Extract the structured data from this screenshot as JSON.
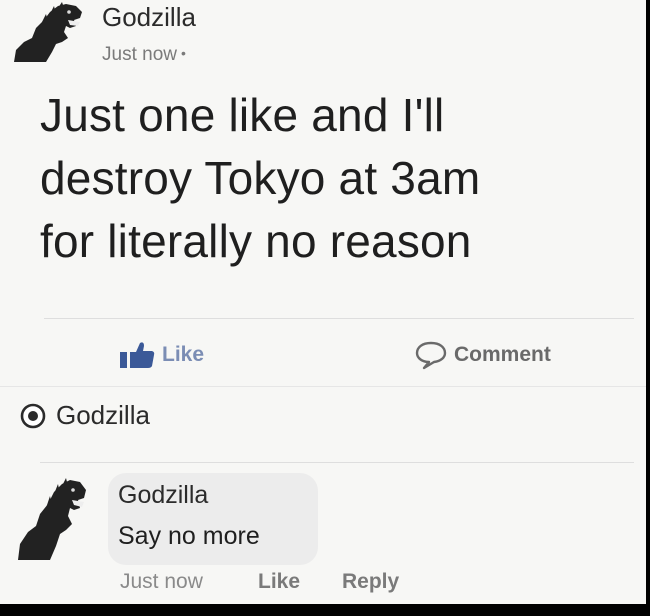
{
  "post": {
    "author": "Godzilla",
    "timestamp": "Just now",
    "privacy_separator": "•",
    "text_lines": [
      "Just one like and I'll",
      "destroy Tokyo at 3am",
      "for literally no reason"
    ],
    "avatar_icon": "godzilla-avatar-icon"
  },
  "actions": {
    "like_label": "Like",
    "comment_label": "Comment",
    "like_icon": "thumbs-up-icon",
    "comment_icon": "speech-bubble-icon",
    "like_color": "#3b5998"
  },
  "liked_by": {
    "name": "Godzilla",
    "icon": "reaction-circle-icon"
  },
  "comment": {
    "author": "Godzilla",
    "text": "Say no more",
    "timestamp": "Just now",
    "like_label": "Like",
    "reply_label": "Reply",
    "avatar_icon": "godzilla-avatar-icon"
  }
}
